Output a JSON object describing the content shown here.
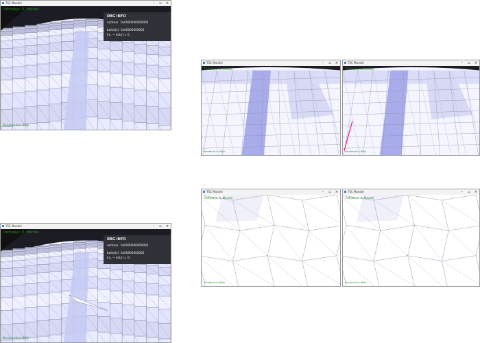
{
  "windows": [
    {
      "id": "w1",
      "title": "TSC Mandel",
      "hud_top": "Pathways: 0, Mandel",
      "fps": "Rendered in 60fp",
      "controls": [
        "–",
        "▫",
        "×"
      ],
      "overlay": {
        "title": "DBG INFO",
        "address_label": "address",
        "address_value": "0x00000000D0000",
        "ballot_label": "ballot[x]",
        "ballot_value": "0x00000000000",
        "index_label": "i[x, ~ data] =",
        "index_value": "0."
      },
      "scene": "dome-dark"
    },
    {
      "id": "w2",
      "title": "TSC Mandel",
      "hud_top": "Pathways: 0, Mandel",
      "fps": "Rendered in 60fp",
      "controls": [
        "–",
        "▫",
        "×"
      ],
      "overlay": {
        "title": "DBG INFO",
        "address_label": "address",
        "address_value": "0x00000000D0000",
        "ballot_label": "ballot[x]",
        "ballot_value": "0x00000000000",
        "index_label": "i[x, ~ data] =",
        "index_value": "0."
      },
      "scene": "dome-dark-sliver"
    },
    {
      "id": "w3",
      "title": "TSC Mandel",
      "hud_top": "Pathways: 0, Mandel",
      "fps": "Rendered in 60fp",
      "controls": [
        "–",
        "▫",
        "×"
      ],
      "scene": "band"
    },
    {
      "id": "w4",
      "title": "TSC Mandel",
      "hud_top": "Pathways: 0, Mandel",
      "fps": "Rendered in 60fp",
      "controls": [
        "–",
        "▫",
        "×"
      ],
      "scene": "band-pink"
    },
    {
      "id": "w5",
      "title": "TSC Mandel",
      "hud_top": "Pathways: 0, Mandel",
      "fps": "Rendered in 60fp",
      "controls": [
        "–",
        "▫",
        "×"
      ],
      "scene": "sparse"
    },
    {
      "id": "w6",
      "title": "TSC Mandel",
      "hud_top": "Pathways: 0, Mandel",
      "fps": "Rendered in 60fp",
      "controls": [
        "–",
        "▫",
        "×"
      ],
      "scene": "sparse"
    }
  ]
}
